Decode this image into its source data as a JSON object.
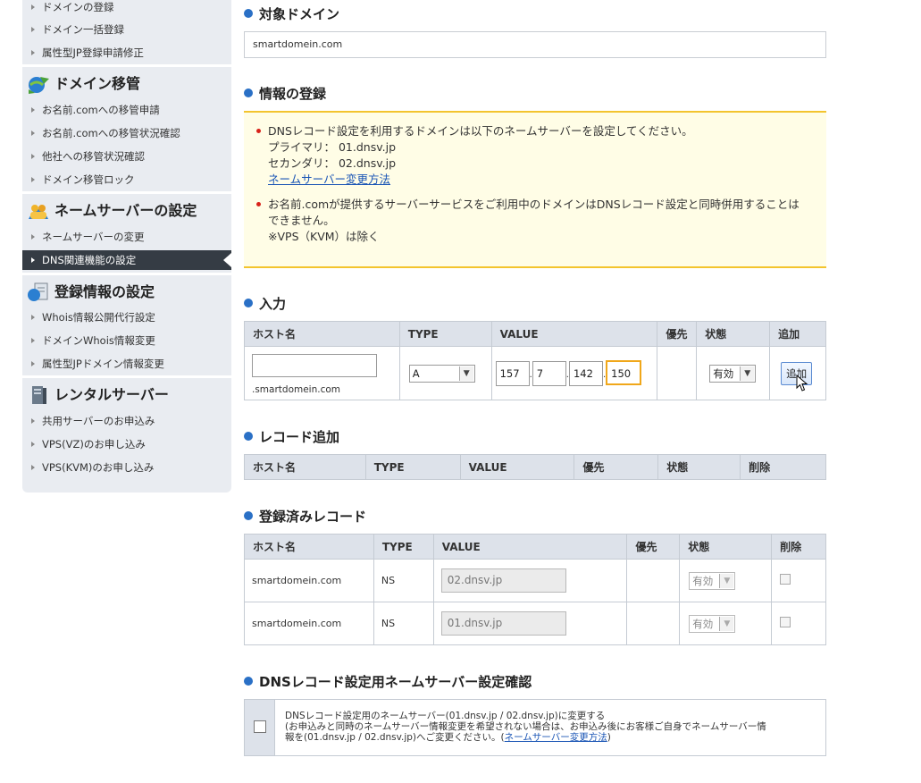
{
  "sidebar": {
    "top_links": [
      "ドメインの登録",
      "ドメイン一括登録",
      "属性型JP登録申請修正"
    ],
    "sections": [
      {
        "title": "ドメイン移管",
        "icon": "globe-arrows-icon",
        "links": [
          "お名前.comへの移管申請",
          "お名前.comへの移管状況確認",
          "他社への移管状況確認",
          "ドメイン移管ロック"
        ]
      },
      {
        "title": "ネームサーバーの設定",
        "icon": "server-users-icon",
        "links": [
          "ネームサーバーの変更",
          "DNS関連機能の設定"
        ]
      },
      {
        "title": "登録情報の設定",
        "icon": "document-info-icon",
        "links": [
          "Whois情報公開代行設定",
          "ドメインWhois情報変更",
          "属性型JPドメイン情報変更"
        ]
      },
      {
        "title": "レンタルサーバー",
        "icon": "rental-server-icon",
        "links": [
          "共用サーバーのお申込み",
          "VPS(VZ)のお申し込み",
          "VPS(KVM)のお申し込み"
        ]
      }
    ],
    "active_link": "DNS関連機能の設定"
  },
  "target_domain": {
    "title": "対象ドメイン",
    "value": "smartdomein.com"
  },
  "info": {
    "title": "情報の登録",
    "item1": {
      "line1": "DNSレコード設定を利用するドメインは以下のネームサーバーを設定してください。",
      "line2": "プライマリ：  01.dnsv.jp",
      "line3": "セカンダリ：  02.dnsv.jp",
      "link": "ネームサーバー変更方法"
    },
    "item2": {
      "line1": "お名前.comが提供するサーバーサービスをご利用中のドメインはDNSレコード設定と同時併用することは",
      "line2": "できません。",
      "line3": "※VPS（KVM）は除く"
    }
  },
  "input_section": {
    "title": "入力",
    "headers": [
      "ホスト名",
      "TYPE",
      "VALUE",
      "優先",
      "状態",
      "追加"
    ],
    "host_value": "",
    "host_suffix": ".smartdomein.com",
    "type_value": "A",
    "ip": [
      "157",
      "7",
      "142",
      "150"
    ],
    "priority": "",
    "status_value": "有効",
    "add_label": "追加"
  },
  "record_add": {
    "title": "レコード追加",
    "headers": [
      "ホスト名",
      "TYPE",
      "VALUE",
      "優先",
      "状態",
      "削除"
    ]
  },
  "registered": {
    "title": "登録済みレコード",
    "headers": [
      "ホスト名",
      "TYPE",
      "VALUE",
      "優先",
      "状態",
      "削除"
    ],
    "rows": [
      {
        "host": "smartdomein.com",
        "type": "NS",
        "value": "02.dnsv.jp",
        "priority": "",
        "status": "有効"
      },
      {
        "host": "smartdomein.com",
        "type": "NS",
        "value": "01.dnsv.jp",
        "priority": "",
        "status": "有効"
      }
    ]
  },
  "confirm": {
    "title": "DNSレコード設定用ネームサーバー設定確認",
    "line1": "DNSレコード設定用のネームサーバー(01.dnsv.jp / 02.dnsv.jp)に変更する",
    "line2": "(お申込みと同時のネームサーバー情報変更を希望されない場合は、お申込み後にお客様ご自身でネームサーバー情",
    "line3_pre": "報を(01.dnsv.jp / 02.dnsv.jp)へご変更ください。(",
    "link": "ネームサーバー変更方法",
    "line3_post": ")"
  },
  "colors": {
    "accent_blue": "#2a70c6",
    "info_border": "#f3c42e",
    "info_bg": "#fffde6",
    "active_nav_bg": "#353c44",
    "link": "#1a55b5"
  }
}
